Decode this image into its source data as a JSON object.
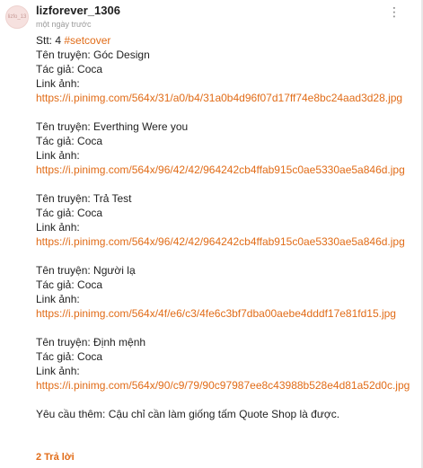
{
  "post": {
    "avatar_text": "lizfo_13",
    "username": "lizforever_1306",
    "timestamp": "một ngày trước",
    "menu_icon": "⋮",
    "stt_label": "Stt: 4",
    "hashtag": "#setcover",
    "labels": {
      "story": "Tên truyện:",
      "author": "Tác giả:",
      "link": "Link ảnh:"
    },
    "entries": [
      {
        "story": "Góc Design",
        "author": "Coca",
        "link": "https://i.pinimg.com/564x/31/a0/b4/31a0b4d96f07d17ff74e8bc24aad3d28.jpg"
      },
      {
        "story": "Everthing Were you",
        "author": "Coca",
        "link": "https://i.pinimg.com/564x/96/42/42/964242cb4ffab915c0ae5330ae5a846d.jpg"
      },
      {
        "story": "Trả Test",
        "author": "Coca",
        "link": "https://i.pinimg.com/564x/96/42/42/964242cb4ffab915c0ae5330ae5a846d.jpg"
      },
      {
        "story": "Người lạ",
        "author": "Coca",
        "link": "https://i.pinimg.com/564x/4f/e6/c3/4fe6c3bf7dba00aebe4dddf17e81fd15.jpg"
      },
      {
        "story": "Định mệnh",
        "author": "Coca",
        "link": "https://i.pinimg.com/564x/90/c9/79/90c97987ee8c43988b528e4d81a52d0c.jpg"
      }
    ],
    "request": "Yêu cầu thêm: Cậu chỉ cần làm giống tấm Quote Shop là được.",
    "replies_label": "2 Trả lời"
  },
  "colors": {
    "accent": "#e16c18",
    "text": "#222222",
    "muted": "#9a9a9a"
  }
}
